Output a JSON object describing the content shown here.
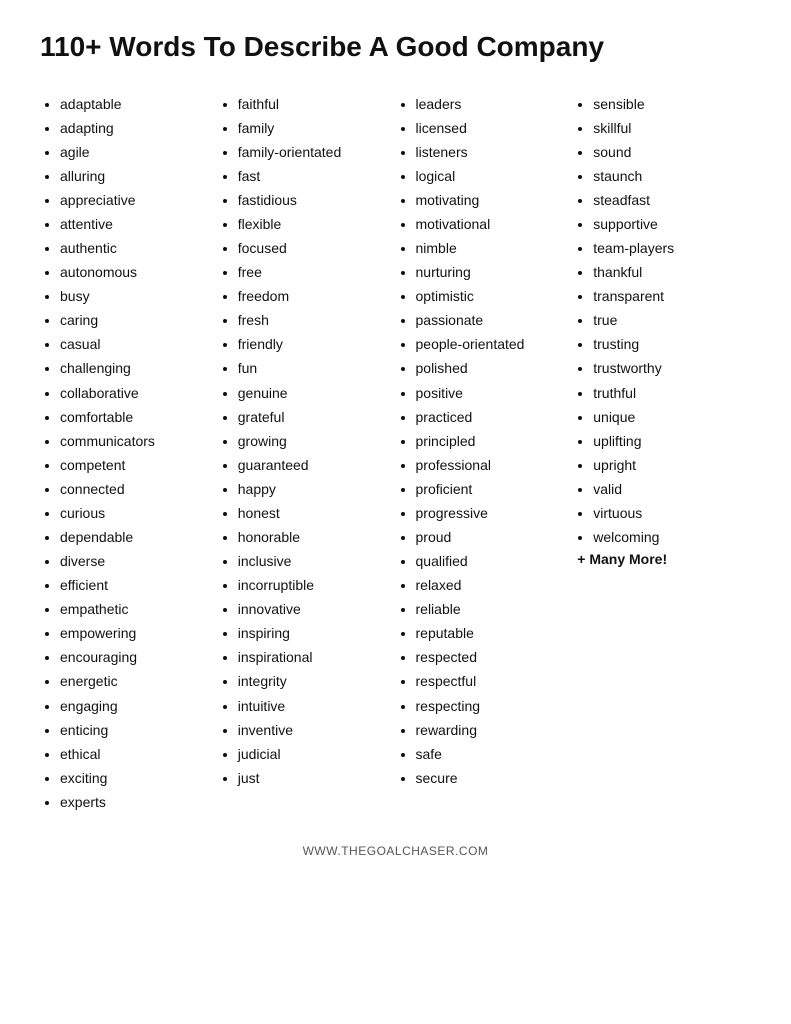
{
  "title": "110+ Words To Describe A Good Company",
  "footer": "WWW.THEGOALCHASER.COM",
  "columns": [
    {
      "id": "col1",
      "items": [
        "adaptable",
        "adapting",
        "agile",
        "alluring",
        "appreciative",
        "attentive",
        "authentic",
        "autonomous",
        "busy",
        "caring",
        "casual",
        "challenging",
        "collaborative",
        "comfortable",
        "communicators",
        "competent",
        "connected",
        "curious",
        "dependable",
        "diverse",
        "efficient",
        "empathetic",
        "empowering",
        "encouraging",
        "energetic",
        "engaging",
        "enticing",
        "ethical",
        "exciting",
        "experts"
      ]
    },
    {
      "id": "col2",
      "items": [
        "faithful",
        "family",
        "family-orientated",
        "fast",
        "fastidious",
        "flexible",
        "focused",
        "free",
        "freedom",
        "fresh",
        "friendly",
        "fun",
        "genuine",
        "grateful",
        "growing",
        "guaranteed",
        "happy",
        "honest",
        "honorable",
        "inclusive",
        "incorruptible",
        "innovative",
        "inspiring",
        "inspirational",
        "integrity",
        "intuitive",
        "inventive",
        "judicial",
        "just"
      ]
    },
    {
      "id": "col3",
      "items": [
        "leaders",
        "licensed",
        "listeners",
        "logical",
        "motivating",
        "motivational",
        "nimble",
        "nurturing",
        "optimistic",
        "passionate",
        "people-orientated",
        "polished",
        "positive",
        "practiced",
        "principled",
        "professional",
        "proficient",
        "progressive",
        "proud",
        "qualified",
        "relaxed",
        "reliable",
        "reputable",
        "respected",
        "respectful",
        "respecting",
        "rewarding",
        "safe",
        "secure"
      ]
    },
    {
      "id": "col4",
      "items": [
        "sensible",
        "skillful",
        "sound",
        "staunch",
        "steadfast",
        "supportive",
        " team-players",
        "thankful",
        "transparent",
        "true",
        "trusting",
        "trustworthy",
        "truthful",
        "unique",
        "uplifting",
        "upright",
        "valid",
        "virtuous",
        "welcoming"
      ],
      "extra": "+ Many More!"
    }
  ]
}
